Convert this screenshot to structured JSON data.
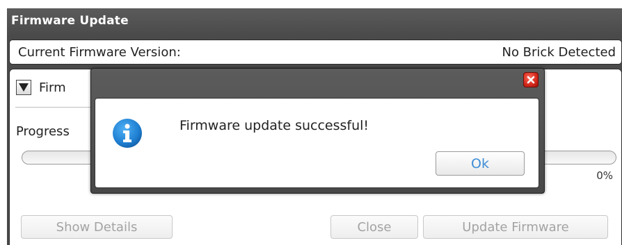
{
  "window": {
    "title": "Firmware Update"
  },
  "firmware": {
    "current_label": "Current Firmware Version:",
    "current_value": "No Brick Detected"
  },
  "panel": {
    "expander_label": "Firm",
    "progress_label": "Progress",
    "progress_percent_text": "0%",
    "progress_fraction": 0
  },
  "buttons": {
    "show_details": "Show Details",
    "close": "Close",
    "update_firmware": "Update Firmware"
  },
  "dialog": {
    "message": "Firmware update successful!",
    "ok_label": "Ok",
    "icon": "info-icon"
  },
  "colors": {
    "accent": "#3e8ed6",
    "info_blue": "#1f7fd1",
    "close_red": "#d4281a",
    "frame_dark": "#4a4a4a",
    "disabled_text": "#a3a3a3"
  }
}
